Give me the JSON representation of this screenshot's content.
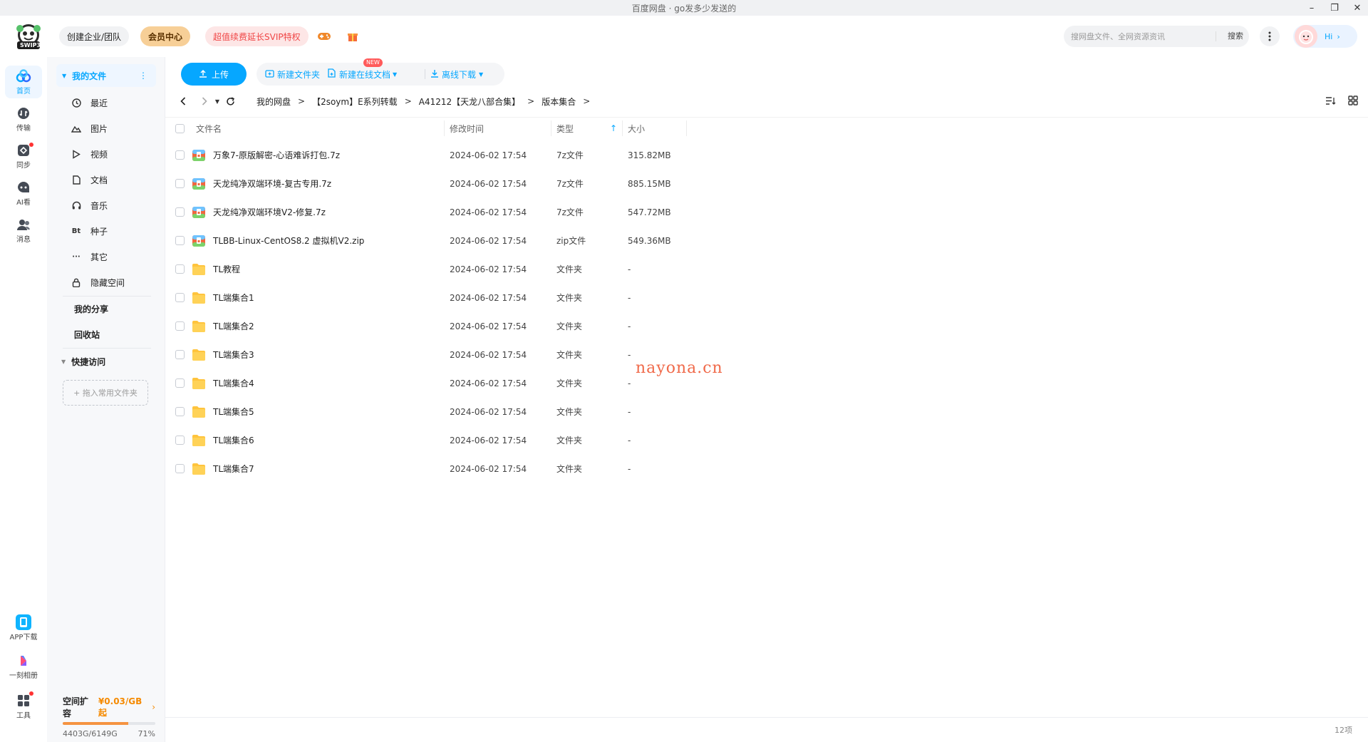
{
  "window": {
    "title": "百度网盘 · go发多少发送的"
  },
  "header": {
    "logo_text": "SWIP3",
    "team_label": "创建企业/团队",
    "vip_label": "会员中心",
    "svip_label": "超值续费延长SVIP特权",
    "search_placeholder": "搜网盘文件、全网资源资讯",
    "search_button": "搜索",
    "hi_label": "Hi"
  },
  "rail": {
    "items": [
      {
        "label": "首页",
        "icon": "cloud-home-icon"
      },
      {
        "label": "传输",
        "icon": "transfer-icon"
      },
      {
        "label": "同步",
        "icon": "sync-icon"
      },
      {
        "label": "AI看",
        "icon": "ai-icon"
      },
      {
        "label": "消息",
        "icon": "message-icon"
      }
    ],
    "bottom_items": [
      {
        "label": "APP下载",
        "icon": "phone-icon"
      },
      {
        "label": "一刻相册",
        "icon": "album-icon"
      },
      {
        "label": "工具",
        "icon": "tools-icon"
      }
    ]
  },
  "sidebar": {
    "my_files": "我的文件",
    "items": [
      {
        "label": "最近",
        "icon": "clock-icon"
      },
      {
        "label": "图片",
        "icon": "image-icon"
      },
      {
        "label": "视频",
        "icon": "play-icon"
      },
      {
        "label": "文档",
        "icon": "doc-icon"
      },
      {
        "label": "音乐",
        "icon": "headphone-icon"
      },
      {
        "label": "种子",
        "icon": "bt-icon",
        "glyph": "Bt"
      },
      {
        "label": "其它",
        "icon": "more-icon",
        "glyph": "···"
      },
      {
        "label": "隐藏空间",
        "icon": "lock-icon"
      }
    ],
    "my_share": "我的分享",
    "recycle": "回收站",
    "quick_access": "快捷访问",
    "drop_hint": "+ 拖入常用文件夹",
    "space": {
      "label": "空间扩容",
      "price": "¥0.03/GB起",
      "used": "4403G/6149G",
      "percent_text": "71%",
      "percent": 71
    }
  },
  "toolbar": {
    "upload": "上传",
    "new_folder": "新建文件夹",
    "new_online_doc": "新建在线文档",
    "new_badge": "NEW",
    "offline_download": "离线下载"
  },
  "breadcrumb": [
    "我的网盘",
    "【2soym】E系列转载",
    "A41212【天龙八部合集】",
    "版本集合"
  ],
  "table": {
    "headers": {
      "name": "文件名",
      "modified": "修改时间",
      "type": "类型",
      "size": "大小"
    },
    "rows": [
      {
        "name": "万象7-原版解密-心语难诉打包.7z",
        "date": "2024-06-02 17:54",
        "type": "7z文件",
        "size": "315.82MB",
        "kind": "archive"
      },
      {
        "name": "天龙纯净双端环境-复古专用.7z",
        "date": "2024-06-02 17:54",
        "type": "7z文件",
        "size": "885.15MB",
        "kind": "archive"
      },
      {
        "name": "天龙纯净双端环境V2-修复.7z",
        "date": "2024-06-02 17:54",
        "type": "7z文件",
        "size": "547.72MB",
        "kind": "archive"
      },
      {
        "name": "TLBB-Linux-CentOS8.2 虚拟机V2.zip",
        "date": "2024-06-02 17:54",
        "type": "zip文件",
        "size": "549.36MB",
        "kind": "archive"
      },
      {
        "name": "TL教程",
        "date": "2024-06-02 17:54",
        "type": "文件夹",
        "size": "-",
        "kind": "folder"
      },
      {
        "name": "TL端集合1",
        "date": "2024-06-02 17:54",
        "type": "文件夹",
        "size": "-",
        "kind": "folder"
      },
      {
        "name": "TL端集合2",
        "date": "2024-06-02 17:54",
        "type": "文件夹",
        "size": "-",
        "kind": "folder"
      },
      {
        "name": "TL端集合3",
        "date": "2024-06-02 17:54",
        "type": "文件夹",
        "size": "-",
        "kind": "folder"
      },
      {
        "name": "TL端集合4",
        "date": "2024-06-02 17:54",
        "type": "文件夹",
        "size": "-",
        "kind": "folder"
      },
      {
        "name": "TL端集合5",
        "date": "2024-06-02 17:54",
        "type": "文件夹",
        "size": "-",
        "kind": "folder"
      },
      {
        "name": "TL端集合6",
        "date": "2024-06-02 17:54",
        "type": "文件夹",
        "size": "-",
        "kind": "folder"
      },
      {
        "name": "TL端集合7",
        "date": "2024-06-02 17:54",
        "type": "文件夹",
        "size": "-",
        "kind": "folder"
      }
    ]
  },
  "watermark": "nayona.cn",
  "footer": {
    "count": "12项"
  },
  "colors": {
    "accent": "#06a7ff",
    "vip": "#f7cf97",
    "svip_text": "#f04646",
    "folder": "#ffc43d",
    "archive": "#f0673f"
  }
}
